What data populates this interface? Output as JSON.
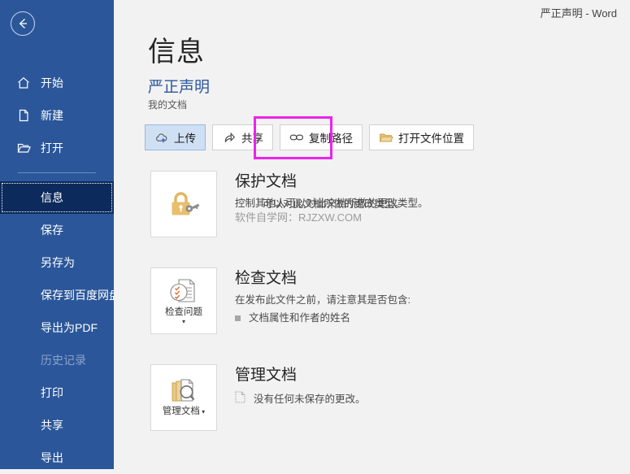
{
  "titlebar": {
    "text": "严正声明  -  Word"
  },
  "sidebar": {
    "back_label": "back-arrow",
    "items": [
      {
        "label": "开始",
        "icon": "home-icon",
        "state": "normal"
      },
      {
        "label": "新建",
        "icon": "new-doc-icon",
        "state": "normal"
      },
      {
        "label": "打开",
        "icon": "open-folder-icon",
        "state": "normal"
      },
      {
        "label": "信息",
        "icon": "",
        "state": "selected"
      },
      {
        "label": "保存",
        "icon": "",
        "state": "normal"
      },
      {
        "label": "另存为",
        "icon": "",
        "state": "normal"
      },
      {
        "label": "保存到百度网盘",
        "icon": "",
        "state": "normal"
      },
      {
        "label": "导出为PDF",
        "icon": "",
        "state": "normal"
      },
      {
        "label": "历史记录",
        "icon": "",
        "state": "disabled"
      },
      {
        "label": "打印",
        "icon": "",
        "state": "normal"
      },
      {
        "label": "共享",
        "icon": "",
        "state": "normal"
      },
      {
        "label": "导出",
        "icon": "",
        "state": "normal"
      }
    ]
  },
  "main": {
    "page_title": "信息",
    "doc_name": "严正声明",
    "doc_location": "我的文档",
    "buttons": [
      {
        "label": "上传",
        "icon": "cloud-upload-icon",
        "state": "active"
      },
      {
        "label": "共享",
        "icon": "share-icon",
        "state": "normal"
      },
      {
        "label": "复制路径",
        "icon": "link-icon",
        "state": "normal"
      },
      {
        "label": "打开文件位置",
        "icon": "folder-icon",
        "state": "normal"
      }
    ],
    "sections": [
      {
        "heading": "保护文档",
        "icon_label": "",
        "icon": "lock-key-icon",
        "desc": "控制其他人可以对此文档所做的更改类型。",
        "desc_overlap": "可以对此文档所做的更改类型。",
        "watermark": "软件自学网：RJZXW.COM"
      },
      {
        "heading": "检查文档",
        "icon_label": "检查问题",
        "icon": "inspect-doc-icon",
        "desc": "在发布此文件之前，请注意其是否包含:",
        "bullet": "文档属性和作者的姓名"
      },
      {
        "heading": "管理文档",
        "icon_label": "管理文档",
        "icon": "manage-doc-icon",
        "desc": "没有任何未保存的更改。"
      }
    ],
    "annotation": {
      "target": "上传",
      "color": "#ec23ec"
    }
  },
  "colors": {
    "sidebar_blue": "#2b579a",
    "selected_navy": "#0c2a5c",
    "accent_blue": "#2b579a",
    "content_bg": "#f2f2f2",
    "annotation": "#ec23ec",
    "gold": "#e0b760"
  }
}
